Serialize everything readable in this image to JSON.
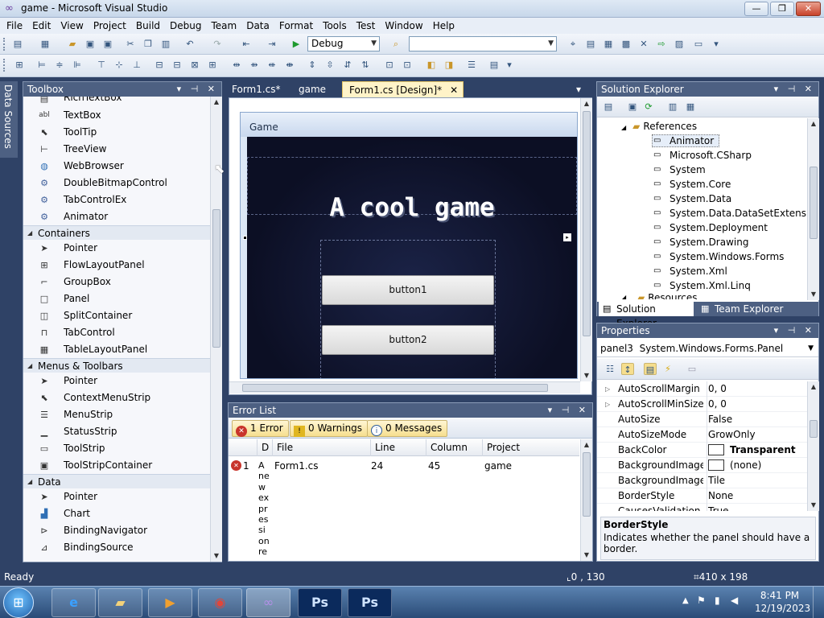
{
  "window": {
    "title": "game - Microsoft Visual Studio",
    "minimize": "—",
    "maximize": "❐",
    "close": "✕"
  },
  "menu": [
    "File",
    "Edit",
    "View",
    "Project",
    "Build",
    "Debug",
    "Team",
    "Data",
    "Format",
    "Tools",
    "Test",
    "Window",
    "Help"
  ],
  "toolbar": {
    "config": "Debug",
    "platform": ""
  },
  "sidetab": {
    "label": "Data Sources"
  },
  "toolbox": {
    "title": "Toolbox",
    "items1": [
      "RichTextBox",
      "TextBox",
      "ToolTip",
      "TreeView",
      "WebBrowser",
      "DoubleBitmapControl",
      "TabControlEx",
      "Animator"
    ],
    "cat_containers": "Containers",
    "containers": [
      "Pointer",
      "FlowLayoutPanel",
      "GroupBox",
      "Panel",
      "SplitContainer",
      "TabControl",
      "TableLayoutPanel"
    ],
    "cat_menus": "Menus & Toolbars",
    "menus": [
      "Pointer",
      "ContextMenuStrip",
      "MenuStrip",
      "StatusStrip",
      "ToolStrip",
      "ToolStripContainer"
    ],
    "cat_data": "Data",
    "data": [
      "Pointer",
      "Chart",
      "BindingNavigator",
      "BindingSource"
    ]
  },
  "doctabs": [
    "Form1.cs*",
    "game",
    "Form1.cs [Design]*"
  ],
  "form": {
    "title": "Game",
    "heading": "A cool game",
    "button1": "button1",
    "button2": "button2"
  },
  "errorlist": {
    "title": "Error List",
    "errors": "1 Error",
    "warnings": "0 Warnings",
    "messages": "0 Messages",
    "columns": [
      "D",
      "File",
      "Line",
      "Column",
      "Project"
    ],
    "row": {
      "num": "1",
      "desc": "A new expression requires (), [], or",
      "file": "Form1.cs",
      "line": "24",
      "column": "45",
      "project": "game"
    }
  },
  "solution": {
    "title": "Solution Explorer",
    "references": "References",
    "refs": [
      "Animator",
      "Microsoft.CSharp",
      "System",
      "System.Core",
      "System.Data",
      "System.Data.DataSetExtensions",
      "System.Deployment",
      "System.Drawing",
      "System.Windows.Forms",
      "System.Xml",
      "System.Xml.Linq"
    ],
    "resources": "Resources",
    "tab1": "Solution Explorer",
    "tab2": "Team Explorer"
  },
  "properties": {
    "title": "Properties",
    "object": "panel3",
    "type": "System.Windows.Forms.Panel",
    "rows": [
      {
        "name": "AutoScrollMargin",
        "value": "0, 0"
      },
      {
        "name": "AutoScrollMinSize",
        "value": "0, 0"
      },
      {
        "name": "AutoSize",
        "value": "False"
      },
      {
        "name": "AutoSizeMode",
        "value": "GrowOnly"
      },
      {
        "name": "BackColor",
        "value": "Transparent"
      },
      {
        "name": "BackgroundImage",
        "value": "(none)"
      },
      {
        "name": "BackgroundImageLa",
        "value": "Tile"
      },
      {
        "name": "BorderStyle",
        "value": "None"
      },
      {
        "name": "CausesValidation",
        "value": "True"
      }
    ],
    "desc_title": "BorderStyle",
    "desc_text": "Indicates whether the panel should have a border."
  },
  "status": {
    "text": "Ready",
    "pos": "0 , 130",
    "size": "410 x 198"
  },
  "clock": {
    "time": "8:41 PM",
    "date": "12/19/2023"
  }
}
